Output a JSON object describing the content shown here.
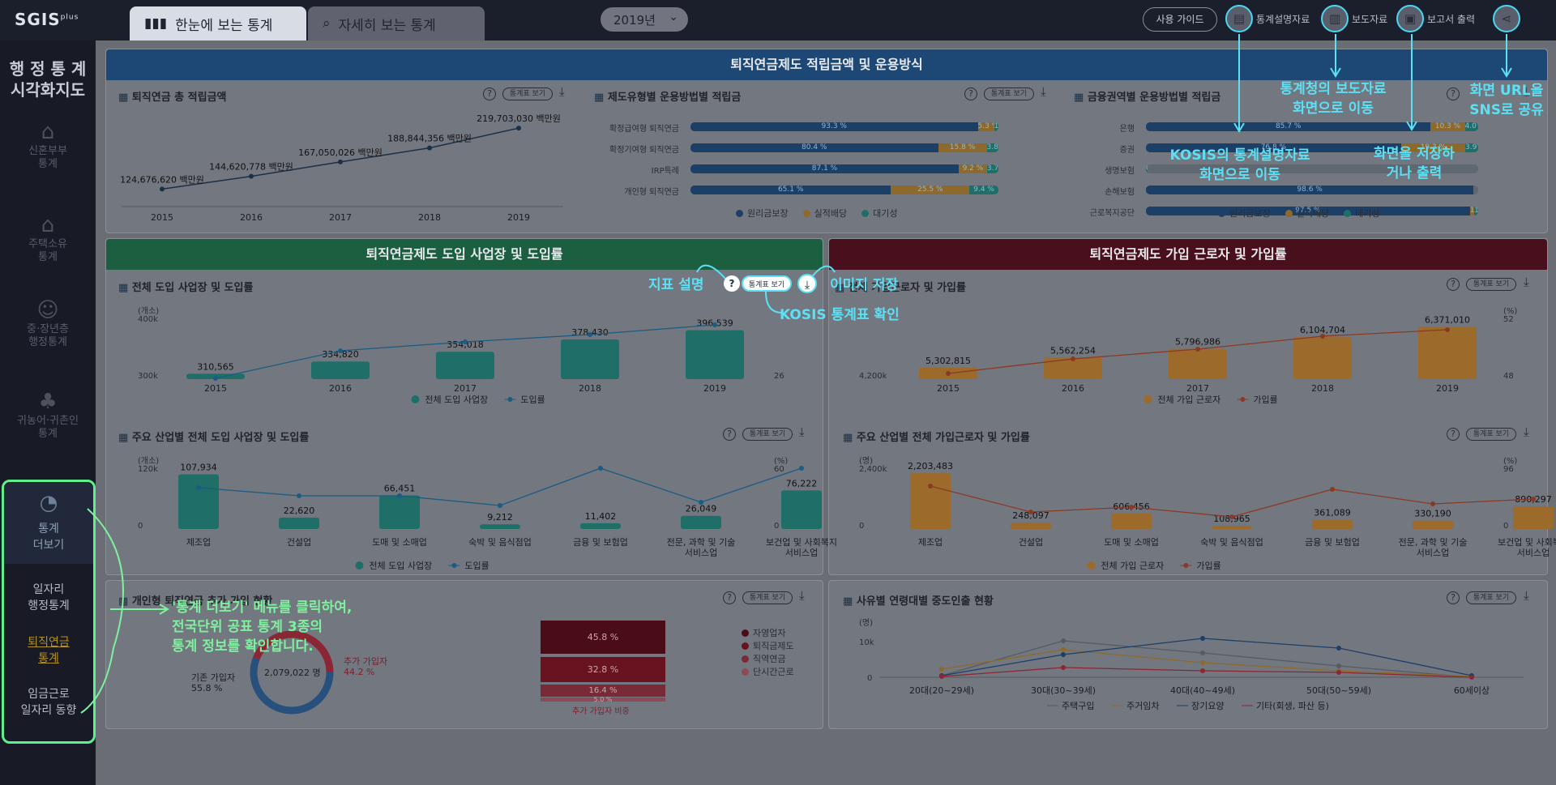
{
  "app": {
    "logo": "SGIS",
    "logo_sup": "plus",
    "title": [
      "행 정 통 계",
      "시각화지도"
    ]
  },
  "tabs": [
    {
      "label": "한눈에 보는 통계"
    },
    {
      "label": "자세히 보는 통계"
    }
  ],
  "year_select": {
    "value": "2019년"
  },
  "toolbar": {
    "guide": "사용 가이드",
    "items": [
      {
        "label": "통계설명자료",
        "icon": "document-icon"
      },
      {
        "label": "보도자료",
        "icon": "book-icon"
      },
      {
        "label": "보고서 출력",
        "icon": "image-icon"
      },
      {
        "label": "",
        "icon": "share-icon"
      }
    ]
  },
  "sidebar": {
    "items": [
      {
        "label": [
          "신혼부부",
          "통계"
        ],
        "icon": "heart-home-icon"
      },
      {
        "label": [
          "주택소유",
          "통계"
        ],
        "icon": "house-icon"
      },
      {
        "label": [
          "중·장년층",
          "행정통계"
        ],
        "icon": "person-icon"
      },
      {
        "label": [
          "귀농어·귀촌인",
          "통계"
        ],
        "icon": "tree-icon"
      }
    ],
    "more": {
      "label": [
        "통계",
        "더보기"
      ],
      "icon": "pie-chart-icon"
    },
    "subitems": [
      {
        "label": [
          "일자리",
          "행정통계"
        ]
      },
      {
        "label": [
          "퇴직연금",
          "통계"
        ],
        "active": true
      },
      {
        "label": [
          "임금근로",
          "일자리 동향"
        ]
      }
    ]
  },
  "common": {
    "stat_btn": "통계표 보기",
    "help": "?"
  },
  "sections": {
    "s1": "퇴직연금제도 적립금액 및 운용방식",
    "s2": "퇴직연금제도 도입 사업장 및 도입률",
    "s3": "퇴직연금제도 가입 근로자 및 가입률"
  },
  "panel_total": {
    "title": "퇴직연금 총 적립금액",
    "years": [
      "2015",
      "2016",
      "2017",
      "2018",
      "2019"
    ],
    "values": [
      124676620,
      144620778,
      167050026,
      188844356,
      219703030
    ],
    "labels": [
      "124,676,620 백만원",
      "144,620,778 백만원",
      "167,050,026 백만원",
      "188,844,356 백만원",
      "219,703,030 백만원"
    ]
  },
  "panel_type": {
    "title": "제도유형별 운용방법별 적립금",
    "rows": [
      {
        "name": "확정급여형 퇴직연금",
        "v": [
          93.3,
          5.3,
          1.4
        ]
      },
      {
        "name": "확정기여형 퇴직연금",
        "v": [
          80.4,
          15.8,
          3.8
        ]
      },
      {
        "name": "IRP특례",
        "v": [
          87.1,
          9.2,
          3.7
        ]
      },
      {
        "name": "개인형 퇴직연금",
        "v": [
          65.1,
          25.5,
          9.4
        ]
      }
    ],
    "legend": [
      "원리금보장",
      "실적배당",
      "대기성"
    ]
  },
  "panel_fin": {
    "title": "금융권역별 운용방법별 적립금",
    "rows": [
      {
        "name": "은행",
        "v": [
          85.7,
          10.3,
          4.0
        ]
      },
      {
        "name": "증권",
        "v": [
          76.8,
          19.3,
          3.9
        ]
      },
      {
        "name": "생명보험",
        "v": [
          0,
          0,
          0.6
        ]
      },
      {
        "name": "손해보험",
        "v": [
          98.6,
          0,
          0.0
        ]
      },
      {
        "name": "근로복지공단",
        "v": [
          97.5,
          1.3,
          1.2
        ]
      }
    ],
    "legend": [
      "원리금보장",
      "실적배당",
      "대기성"
    ]
  },
  "panel_intro": {
    "title": "전체 도입 사업장 및 도입률",
    "yunit": "(개소)",
    "yticks": [
      "400k",
      "300k"
    ],
    "rticks": [
      "",
      "26"
    ],
    "years": [
      "2015",
      "2016",
      "2017",
      "2018",
      "2019"
    ],
    "values": [
      310565,
      334820,
      354018,
      378430,
      396539
    ],
    "labels": [
      "310,565",
      "334,820",
      "354,018",
      "378,430",
      "396,539"
    ],
    "legend": [
      "전체 도입 사업장",
      "도입률"
    ]
  },
  "panel_join": {
    "title": "전체 가입근로자 및 가입률",
    "yunit": "",
    "rtick_unit": "(%)",
    "yticks": [
      "4,200k"
    ],
    "rticks": [
      "52",
      "48"
    ],
    "years": [
      "2015",
      "2016",
      "2017",
      "2018",
      "2019"
    ],
    "values": [
      5302815,
      5562254,
      5796986,
      6104704,
      6371010
    ],
    "labels": [
      "5,302,815",
      "5,562,254",
      "5,796,986",
      "6,104,704",
      "6,371,010"
    ],
    "legend": [
      "전체 가입 근로자",
      "가입률"
    ]
  },
  "panel_ind_intro": {
    "title": "주요 산업별 전체 도입 사업장 및 도입률",
    "yunit": "(개소)",
    "runit": "(%)",
    "yticks": [
      "120k",
      "0"
    ],
    "rticks": [
      "60",
      "0"
    ],
    "cats": [
      "제조업",
      "건설업",
      "도매 및 소매업",
      "숙박 및 음식점업",
      "금융 및 보험업",
      "전문, 과학 및 기술 서비스업",
      "보건업 및 사회복지 서비스업"
    ],
    "values": [
      107934,
      22620,
      66451,
      9212,
      11402,
      26049,
      76222
    ],
    "labels": [
      "107,934",
      "22,620",
      "66,451",
      "9,212",
      "11,402",
      "26,049",
      "76,222"
    ],
    "legend": [
      "전체 도입 사업장",
      "도입률"
    ]
  },
  "panel_ind_join": {
    "title": "주요 산업별 전체 가입근로자 및 가입률",
    "yunit": "(명)",
    "runit": "(%)",
    "yticks": [
      "2,400k",
      "0"
    ],
    "rticks": [
      "96",
      "0"
    ],
    "cats": [
      "제조업",
      "건설업",
      "도매 및 소매업",
      "숙박 및 음식점업",
      "금융 및 보험업",
      "전문, 과학 및 기술 서비스업",
      "보건업 및 사회복지 서비스업"
    ],
    "values": [
      2203483,
      248097,
      606456,
      108965,
      361089,
      330190,
      890297
    ],
    "labels": [
      "2,203,483",
      "248,097",
      "606,456",
      "108,965",
      "361,089",
      "330,190",
      "890,297"
    ],
    "legend": [
      "전체 가입 근로자",
      "가입률"
    ]
  },
  "panel_irp": {
    "title": "개인형 퇴직연금 추가 가입 현황",
    "existing_label": "기존 가입자",
    "existing_pct": "55.8 %",
    "added_label": "추가 가입자",
    "added_pct": "44.2 %",
    "center": "2,079,022 명",
    "stack": [
      "45.8 %",
      "32.8 %",
      "16.4 %",
      "5.0 %"
    ],
    "stack_label": "추가 가입자 비중",
    "legend": [
      "자영업자",
      "퇴직금제도",
      "직역연금",
      "단시간근로"
    ]
  },
  "panel_mid": {
    "title": "사유별 연령대별 중도인출 현황",
    "yunit": "(명)",
    "yticks": [
      "10k",
      "0"
    ],
    "cats": [
      "20대(20~29세)",
      "30대(30~39세)",
      "40대(40~49세)",
      "50대(50~59세)",
      "60세이상"
    ],
    "legend": [
      "주택구입",
      "주거임차",
      "장기요양",
      "기타(회생, 파산 등)"
    ]
  },
  "annotations": {
    "toolbar": [
      "KOSIS의 통계설명자료 화면으로 이동",
      "통계청의 보도자료 화면으로 이동",
      "화면을 저장하거나 출력",
      "화면 URL을 SNS로 공유"
    ],
    "help": "지표 설명",
    "download": "이미지 저장",
    "stattable": "KOSIS 통계표 확인",
    "more": [
      "'통계 더보기' 메뉴를 클릭하여,",
      "전국단위 공표 통계 3종의",
      "통계 정보를 확인합니다."
    ]
  }
}
